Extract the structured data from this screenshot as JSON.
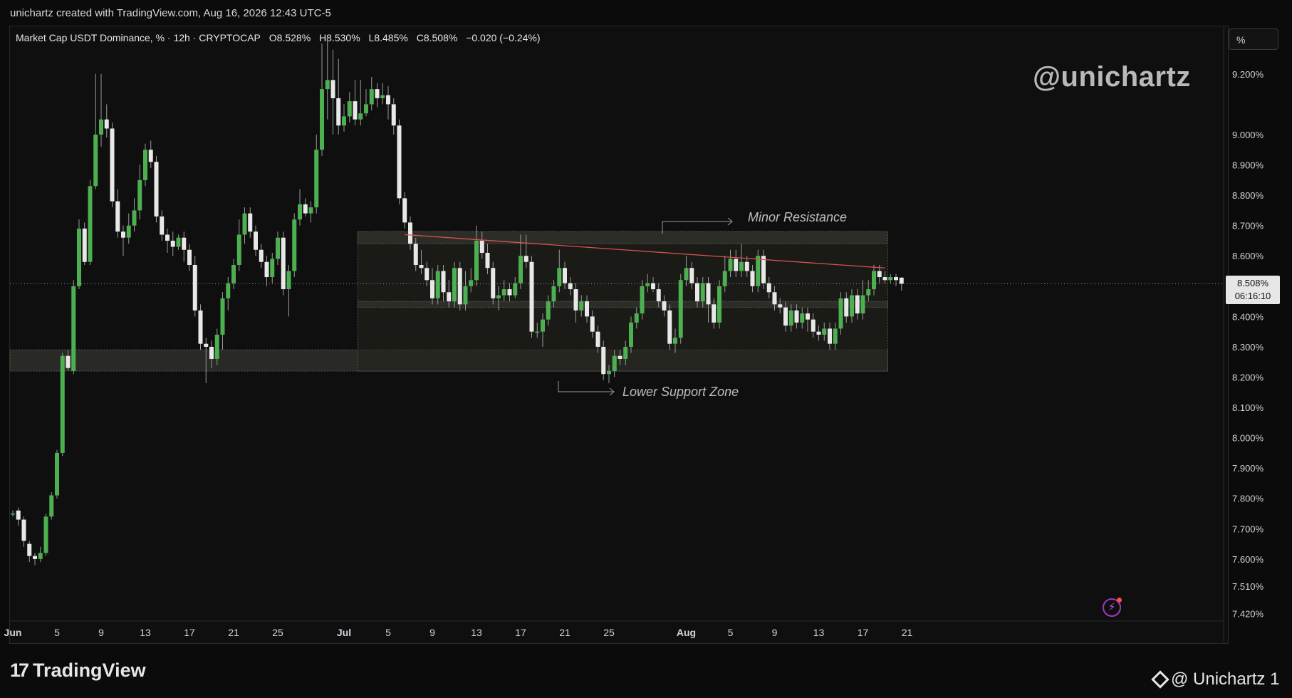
{
  "header": {
    "caption": "unichartz created with TradingView.com, Aug 16, 2026 12:43 UTC-5",
    "symbol_title": "Market Cap USDT Dominance, % · 12h · CRYPTOCAP",
    "ohlc": {
      "open": "O8.528%",
      "high": "H8.530%",
      "low": "L8.485%",
      "close": "C8.508%",
      "change": "−0.020 (−0.24%)"
    }
  },
  "toolbar": {
    "percent_toggle": "%"
  },
  "watermark": "@unichartz",
  "annotations": {
    "minor_resistance": "Minor Resistance",
    "lower_support": "Lower Support Zone"
  },
  "price_label": {
    "value": "8.508%",
    "countdown": "06:16:10"
  },
  "footer": {
    "brand": "TradingView",
    "brand_logo": "17",
    "author": "@ Unichartz 1"
  },
  "colors": {
    "up": "#4caf50",
    "down": "#e8e8e8",
    "resistance_line": "#d9534f",
    "zone_fill": "#3a3a34",
    "zone_border": "#555555"
  },
  "chart_data": {
    "type": "candlestick",
    "title": "Market Cap USDT Dominance, % · 12h · CRYPTOCAP",
    "ylabel": "%",
    "ylim": [
      7.4,
      9.35
    ],
    "y_ticks": [
      9.2,
      9.0,
      8.9,
      8.8,
      8.7,
      8.6,
      8.5,
      8.4,
      8.3,
      8.2,
      8.1,
      8.0,
      7.9,
      7.8,
      7.7,
      7.6,
      7.51,
      7.42
    ],
    "y_tick_labels": [
      "9.200%",
      "9.000%",
      "8.900%",
      "8.800%",
      "8.700%",
      "8.600%",
      "8.500%",
      "8.400%",
      "8.300%",
      "8.200%",
      "8.100%",
      "8.000%",
      "7.900%",
      "7.800%",
      "7.700%",
      "7.600%",
      "7.510%",
      "7.420%"
    ],
    "x_tick_labels": [
      "Jun",
      "5",
      "9",
      "13",
      "17",
      "21",
      "25",
      "Jul",
      "5",
      "9",
      "13",
      "17",
      "21",
      "25",
      "Aug",
      "5",
      "9",
      "13",
      "17",
      "21"
    ],
    "x_tick_index": [
      0,
      8,
      16,
      24,
      32,
      40,
      48,
      60,
      68,
      76,
      84,
      92,
      100,
      108,
      122,
      130,
      138,
      146,
      154,
      162
    ],
    "current_price": 8.508,
    "zones": [
      {
        "name": "Lower Support Zone",
        "start_index": 0,
        "end_index": 158,
        "y_low": 8.22,
        "y_high": 8.29
      },
      {
        "name": "Range",
        "start_index": 63,
        "end_index": 158,
        "y_low": 8.22,
        "y_high": 8.68
      },
      {
        "name": "Minor Resistance",
        "start_index": 63,
        "end_index": 158,
        "y_low": 8.64,
        "y_high": 8.68
      },
      {
        "name": "Mid band",
        "start_index": 63,
        "end_index": 158,
        "y_low": 8.43,
        "y_high": 8.45
      }
    ],
    "resistance_line": {
      "start_index": 71,
      "start_value": 8.67,
      "end_index": 158,
      "end_value": 8.56
    },
    "candles": [
      [
        7.75,
        7.75,
        7.74,
        7.76
      ],
      [
        7.76,
        7.73,
        7.71,
        7.77
      ],
      [
        7.73,
        7.66,
        7.64,
        7.74
      ],
      [
        7.65,
        7.61,
        7.59,
        7.66
      ],
      [
        7.61,
        7.6,
        7.58,
        7.62
      ],
      [
        7.6,
        7.62,
        7.59,
        7.64
      ],
      [
        7.62,
        7.74,
        7.61,
        7.75
      ],
      [
        7.74,
        7.81,
        7.73,
        7.82
      ],
      [
        7.81,
        7.95,
        7.8,
        7.96
      ],
      [
        7.95,
        8.27,
        7.94,
        8.28
      ],
      [
        8.27,
        8.23,
        8.22,
        8.29
      ],
      [
        8.22,
        8.5,
        8.21,
        8.52
      ],
      [
        8.5,
        8.69,
        8.49,
        8.72
      ],
      [
        8.69,
        8.58,
        8.57,
        8.71
      ],
      [
        8.58,
        8.83,
        8.57,
        8.85
      ],
      [
        8.83,
        9.0,
        8.82,
        9.2
      ],
      [
        9.0,
        9.05,
        8.96,
        9.2
      ],
      [
        9.05,
        9.02,
        8.99,
        9.1
      ],
      [
        9.02,
        8.78,
        8.76,
        9.04
      ],
      [
        8.78,
        8.68,
        8.66,
        8.82
      ],
      [
        8.68,
        8.66,
        8.6,
        8.7
      ],
      [
        8.66,
        8.7,
        8.64,
        8.74
      ],
      [
        8.7,
        8.75,
        8.68,
        8.79
      ],
      [
        8.75,
        8.85,
        8.72,
        8.9
      ],
      [
        8.85,
        8.95,
        8.83,
        8.97
      ],
      [
        8.95,
        8.91,
        8.89,
        8.98
      ],
      [
        8.91,
        8.73,
        8.71,
        8.93
      ],
      [
        8.73,
        8.67,
        8.65,
        8.75
      ],
      [
        8.67,
        8.65,
        8.61,
        8.69
      ],
      [
        8.65,
        8.63,
        8.6,
        8.68
      ],
      [
        8.63,
        8.66,
        8.62,
        8.67
      ],
      [
        8.66,
        8.62,
        8.58,
        8.68
      ],
      [
        8.62,
        8.57,
        8.55,
        8.64
      ],
      [
        8.57,
        8.42,
        8.4,
        8.6
      ],
      [
        8.42,
        8.31,
        8.29,
        8.44
      ],
      [
        8.31,
        8.3,
        8.18,
        8.33
      ],
      [
        8.3,
        8.26,
        8.23,
        8.32
      ],
      [
        8.26,
        8.34,
        8.24,
        8.36
      ],
      [
        8.34,
        8.46,
        8.29,
        8.48
      ],
      [
        8.46,
        8.51,
        8.42,
        8.53
      ],
      [
        8.51,
        8.57,
        8.49,
        8.59
      ],
      [
        8.57,
        8.67,
        8.55,
        8.72
      ],
      [
        8.67,
        8.74,
        8.64,
        8.76
      ],
      [
        8.74,
        8.68,
        8.66,
        8.76
      ],
      [
        8.68,
        8.62,
        8.6,
        8.7
      ],
      [
        8.62,
        8.58,
        8.56,
        8.64
      ],
      [
        8.58,
        8.53,
        8.5,
        8.6
      ],
      [
        8.53,
        8.59,
        8.51,
        8.61
      ],
      [
        8.59,
        8.66,
        8.57,
        8.68
      ],
      [
        8.66,
        8.49,
        8.47,
        8.68
      ],
      [
        8.49,
        8.55,
        8.4,
        8.57
      ],
      [
        8.55,
        8.72,
        8.53,
        8.74
      ],
      [
        8.72,
        8.77,
        8.7,
        8.82
      ],
      [
        8.77,
        8.74,
        8.73,
        8.79
      ],
      [
        8.74,
        8.76,
        8.71,
        8.78
      ],
      [
        8.76,
        8.95,
        8.74,
        9.0
      ],
      [
        8.95,
        9.15,
        8.93,
        9.3
      ],
      [
        9.15,
        9.18,
        9.05,
        9.32
      ],
      [
        9.18,
        9.12,
        9.0,
        9.28
      ],
      [
        9.12,
        9.03,
        9.0,
        9.25
      ],
      [
        9.03,
        9.06,
        9.01,
        9.1
      ],
      [
        9.06,
        9.11,
        9.04,
        9.14
      ],
      [
        9.11,
        9.05,
        9.03,
        9.18
      ],
      [
        9.05,
        9.07,
        9.03,
        9.18
      ],
      [
        9.07,
        9.1,
        9.06,
        9.15
      ],
      [
        9.1,
        9.15,
        9.08,
        9.19
      ],
      [
        9.15,
        9.12,
        9.09,
        9.17
      ],
      [
        9.12,
        9.13,
        9.1,
        9.17
      ],
      [
        9.13,
        9.1,
        9.05,
        9.16
      ],
      [
        9.1,
        9.03,
        9.0,
        9.12
      ],
      [
        9.03,
        8.79,
        8.77,
        9.05
      ],
      [
        8.79,
        8.71,
        8.69,
        8.81
      ],
      [
        8.71,
        8.64,
        8.62,
        8.73
      ],
      [
        8.64,
        8.57,
        8.55,
        8.66
      ],
      [
        8.57,
        8.56,
        8.54,
        8.62
      ],
      [
        8.56,
        8.52,
        8.5,
        8.58
      ],
      [
        8.52,
        8.46,
        8.44,
        8.56
      ],
      [
        8.46,
        8.55,
        8.44,
        8.57
      ],
      [
        8.55,
        8.48,
        8.45,
        8.57
      ],
      [
        8.48,
        8.45,
        8.43,
        8.52
      ],
      [
        8.45,
        8.56,
        8.43,
        8.58
      ],
      [
        8.56,
        8.44,
        8.42,
        8.58
      ],
      [
        8.44,
        8.5,
        8.42,
        8.55
      ],
      [
        8.5,
        8.52,
        8.48,
        8.56
      ],
      [
        8.52,
        8.65,
        8.5,
        8.7
      ],
      [
        8.65,
        8.61,
        8.59,
        8.68
      ],
      [
        8.61,
        8.56,
        8.54,
        8.64
      ],
      [
        8.56,
        8.46,
        8.44,
        8.58
      ],
      [
        8.46,
        8.47,
        8.42,
        8.5
      ],
      [
        8.47,
        8.49,
        8.45,
        8.52
      ],
      [
        8.49,
        8.47,
        8.45,
        8.51
      ],
      [
        8.47,
        8.51,
        8.46,
        8.53
      ],
      [
        8.51,
        8.6,
        8.49,
        8.67
      ],
      [
        8.6,
        8.58,
        8.56,
        8.67
      ],
      [
        8.58,
        8.35,
        8.33,
        8.6
      ],
      [
        8.35,
        8.35,
        8.33,
        8.38
      ],
      [
        8.35,
        8.39,
        8.3,
        8.41
      ],
      [
        8.39,
        8.45,
        8.37,
        8.47
      ],
      [
        8.45,
        8.5,
        8.43,
        8.52
      ],
      [
        8.5,
        8.56,
        8.48,
        8.62
      ],
      [
        8.56,
        8.51,
        8.49,
        8.58
      ],
      [
        8.51,
        8.49,
        8.47,
        8.53
      ],
      [
        8.49,
        8.42,
        8.38,
        8.51
      ],
      [
        8.42,
        8.45,
        8.4,
        8.47
      ],
      [
        8.45,
        8.4,
        8.38,
        8.47
      ],
      [
        8.4,
        8.35,
        8.33,
        8.42
      ],
      [
        8.35,
        8.3,
        8.28,
        8.37
      ],
      [
        8.3,
        8.21,
        8.19,
        8.32
      ],
      [
        8.21,
        8.22,
        8.18,
        8.24
      ],
      [
        8.22,
        8.27,
        8.2,
        8.29
      ],
      [
        8.27,
        8.26,
        8.24,
        8.29
      ],
      [
        8.26,
        8.3,
        8.24,
        8.32
      ],
      [
        8.3,
        8.38,
        8.28,
        8.4
      ],
      [
        8.38,
        8.41,
        8.36,
        8.43
      ],
      [
        8.41,
        8.5,
        8.39,
        8.52
      ],
      [
        8.5,
        8.51,
        8.48,
        8.54
      ],
      [
        8.51,
        8.49,
        8.48,
        8.53
      ],
      [
        8.49,
        8.45,
        8.43,
        8.51
      ],
      [
        8.45,
        8.42,
        8.4,
        8.47
      ],
      [
        8.42,
        8.31,
        8.29,
        8.44
      ],
      [
        8.31,
        8.33,
        8.28,
        8.36
      ],
      [
        8.33,
        8.52,
        8.31,
        8.54
      ],
      [
        8.52,
        8.56,
        8.5,
        8.6
      ],
      [
        8.56,
        8.51,
        8.49,
        8.58
      ],
      [
        8.51,
        8.45,
        8.43,
        8.53
      ],
      [
        8.45,
        8.51,
        8.43,
        8.53
      ],
      [
        8.51,
        8.44,
        8.38,
        8.53
      ],
      [
        8.44,
        8.38,
        8.36,
        8.46
      ],
      [
        8.38,
        8.5,
        8.36,
        8.52
      ],
      [
        8.5,
        8.55,
        8.48,
        8.6
      ],
      [
        8.55,
        8.59,
        8.53,
        8.62
      ],
      [
        8.59,
        8.55,
        8.53,
        8.62
      ],
      [
        8.55,
        8.58,
        8.53,
        8.64
      ],
      [
        8.58,
        8.55,
        8.53,
        8.6
      ],
      [
        8.55,
        8.5,
        8.48,
        8.57
      ],
      [
        8.5,
        8.6,
        8.48,
        8.62
      ],
      [
        8.6,
        8.51,
        8.49,
        8.62
      ],
      [
        8.51,
        8.48,
        8.46,
        8.53
      ],
      [
        8.48,
        8.44,
        8.42,
        8.5
      ],
      [
        8.44,
        8.43,
        8.41,
        8.46
      ],
      [
        8.43,
        8.37,
        8.35,
        8.45
      ],
      [
        8.37,
        8.42,
        8.35,
        8.44
      ],
      [
        8.42,
        8.38,
        8.36,
        8.44
      ],
      [
        8.38,
        8.41,
        8.36,
        8.43
      ],
      [
        8.41,
        8.39,
        8.35,
        8.43
      ],
      [
        8.39,
        8.35,
        8.33,
        8.41
      ],
      [
        8.35,
        8.34,
        8.32,
        8.37
      ],
      [
        8.34,
        8.36,
        8.32,
        8.38
      ],
      [
        8.36,
        8.31,
        8.29,
        8.38
      ],
      [
        8.31,
        8.36,
        8.29,
        8.38
      ],
      [
        8.36,
        8.46,
        8.34,
        8.48
      ],
      [
        8.46,
        8.4,
        8.38,
        8.48
      ],
      [
        8.4,
        8.47,
        8.38,
        8.49
      ],
      [
        8.47,
        8.41,
        8.39,
        8.49
      ],
      [
        8.41,
        8.47,
        8.39,
        8.52
      ],
      [
        8.47,
        8.49,
        8.45,
        8.52
      ],
      [
        8.49,
        8.55,
        8.47,
        8.57
      ],
      [
        8.55,
        8.53,
        8.51,
        8.57
      ],
      [
        8.53,
        8.52,
        8.51,
        8.55
      ],
      [
        8.52,
        8.53,
        8.51,
        8.54
      ],
      [
        8.53,
        8.52,
        8.5,
        8.54
      ],
      [
        8.528,
        8.508,
        8.485,
        8.53
      ]
    ]
  }
}
